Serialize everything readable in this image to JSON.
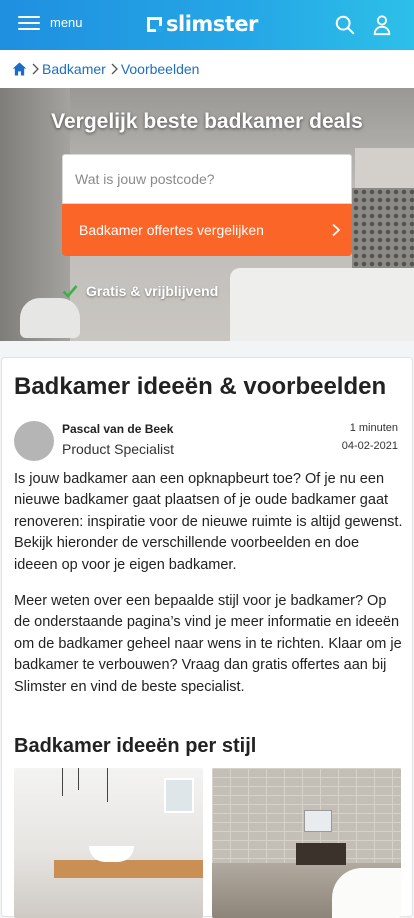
{
  "header": {
    "menu_label": "menu",
    "logo_text": "slimster",
    "background_gradient": [
      "#1f8fe0",
      "#2dc0e8"
    ],
    "icons": [
      "hamburger-icon",
      "search-icon",
      "user-icon"
    ]
  },
  "breadcrumb": {
    "items": [
      "Badkamer",
      "Voorbeelden"
    ],
    "home_icon": "home-icon"
  },
  "hero": {
    "title": "Vergelijk beste badkamer deals",
    "postcode_placeholder": "Wat is jouw postcode?",
    "cta_label": "Badkamer offertes vergelijken",
    "cta_color": "#fb6528",
    "free_label": "Gratis & vrijblijvend",
    "check_color": "#35b34a"
  },
  "article": {
    "title": "Badkamer ideeën & voorbeelden",
    "author": "Pascal van de Beek",
    "role": "Product Specialist",
    "read_time": "1 minuten",
    "date": "04-02-2021",
    "paragraphs": [
      "Is jouw badkamer aan een opknapbeurt toe? Of je nu een nieuwe badkamer gaat plaatsen of je oude badkamer gaat renoveren: inspiratie voor de nieuwe ruimte is altijd gewenst. Bekijk hieronder de verschillende voorbeelden en doe ideeen op voor je eigen badkamer.",
      "Meer weten over een bepaalde stijl voor je badkamer? Op de onderstaande pagina’s vind je meer informatie en ideeën om de badkamer geheel naar wens in te richten. Klaar om je badkamer te verbouwen? Vraag dan gratis offertes aan bij Slimster en vind de beste specialist."
    ],
    "section_title": "Badkamer ideeën per stijl"
  }
}
